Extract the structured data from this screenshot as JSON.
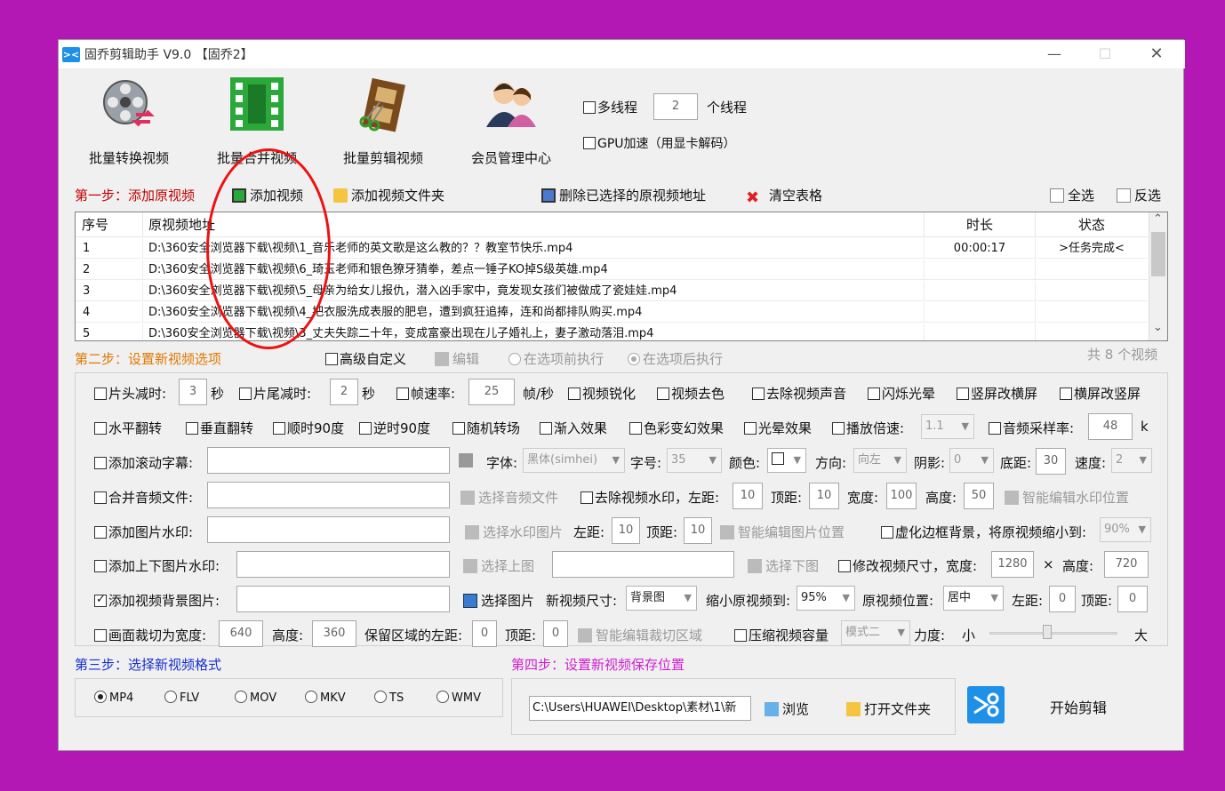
{
  "window": {
    "title": "固乔剪辑助手 V9.0 【固乔2】",
    "app_icon": "scissors-icon",
    "min_glyph": "—",
    "max_glyph": "☐",
    "close_glyph": "✕"
  },
  "toolbar": {
    "batch_convert": "批量转换视频",
    "batch_merge": "批量合并视频",
    "batch_edit": "批量剪辑视频",
    "member_center": "会员管理中心",
    "multithread_label": "多线程",
    "thread_count": "2",
    "thread_unit": "个线程",
    "gpu_label": "GPU加速（用显卡解码）"
  },
  "step1": {
    "title": "第一步：添加原视频",
    "add_video": "添加视频",
    "add_folder": "添加视频文件夹",
    "delete_selected": "删除已选择的原视频地址",
    "clear_table": "清空表格",
    "select_all": "全选",
    "invert": "反选"
  },
  "table": {
    "headers": [
      "序号",
      "原视频地址",
      "时长",
      "状态"
    ],
    "rows": [
      {
        "idx": "1",
        "path": "D:\\360安全浏览器下载\\视频\\1_音乐老师的英文歌是这么教的？？教室节快乐.mp4",
        "duration": "00:00:17",
        "status": ">任务完成<"
      },
      {
        "idx": "2",
        "path": "D:\\360安全浏览器下载\\视频\\6_琦玉老师和银色獠牙猜拳，差点一锤子KO掉S级英雄.mp4",
        "duration": "",
        "status": ""
      },
      {
        "idx": "3",
        "path": "D:\\360安全浏览器下载\\视频\\5_母亲为给女儿报仇，潜入凶手家中，竟发现女孩们被做成了瓷娃娃.mp4",
        "duration": "",
        "status": ""
      },
      {
        "idx": "4",
        "path": "D:\\360安全浏览器下载\\视频\\4_把衣服洗成表服的肥皂，遭到疯狂追捧，连和尚都排队购买.mp4",
        "duration": "",
        "status": ""
      },
      {
        "idx": "5",
        "path": "D:\\360安全浏览器下载\\视频\\3_丈夫失踪二十年，变成富豪出现在儿子婚礼上，妻子激动落泪.mp4",
        "duration": "",
        "status": ""
      }
    ],
    "scroll_up": "⌃",
    "scroll_down": "⌄"
  },
  "step2": {
    "title": "第二步：设置新视频选项",
    "advanced": "高级自定义",
    "edit": "编辑",
    "before": "在选项前执行",
    "after": "在选项后执行",
    "count_text": "共 8 个视频"
  },
  "opts": {
    "head_cut": "片头减时:",
    "head_val": "3",
    "sec1": "秒",
    "tail_cut": "片尾减时:",
    "tail_val": "2",
    "sec2": "秒",
    "fps": "帧速率:",
    "fps_val": "25",
    "fps_unit": "帧/秒",
    "sharpen": "视频锐化",
    "decolor": "视频去色",
    "remove_audio": "去除视频声音",
    "flash": "闪烁光晕",
    "v2h": "竖屏改横屏",
    "h2v": "横屏改竖屏",
    "hflip": "水平翻转",
    "vflip": "垂直翻转",
    "cw90": "顺时90度",
    "ccw90": "逆时90度",
    "random_trans": "随机转场",
    "fade_in": "渐入效果",
    "color_fx": "色彩变幻效果",
    "halo": "光晕效果",
    "speed": "播放倍速:",
    "speed_val": "1.1",
    "sample": "音频采样率:",
    "sample_val": "48",
    "sample_unit": "k",
    "subtitle": "添加滚动字幕:",
    "font": "字体:",
    "font_val": "黑体(simhei)",
    "size": "字号:",
    "size_val": "35",
    "color": "颜色:",
    "direction": "方向:",
    "direction_val": "向左",
    "shadow": "阴影:",
    "shadow_val": "0",
    "bottom": "底距:",
    "bottom_val": "30",
    "spd": "速度:",
    "spd_val": "2",
    "merge_audio": "合并音频文件:",
    "choose_audio": "选择音频文件",
    "remove_wm": "去除视频水印，左距:",
    "wm_left": "10",
    "wm_top_lbl": "顶距:",
    "wm_top": "10",
    "wm_w_lbl": "宽度:",
    "wm_w": "100",
    "wm_h_lbl": "高度:",
    "wm_h": "50",
    "smart_wm": "智能编辑水印位置",
    "img_wm": "添加图片水印:",
    "choose_wm": "选择水印图片",
    "iw_left_lbl": "左距:",
    "iw_left": "10",
    "iw_top_lbl": "顶距:",
    "iw_top": "10",
    "smart_img": "智能编辑图片位置",
    "blur": "虚化边框背景，将原视频缩小到:",
    "blur_val": "90%",
    "tb_img": "添加上下图片水印:",
    "choose_top": "选择上图",
    "choose_bottom": "选择下图",
    "resize": "修改视频尺寸，宽度:",
    "res_w": "1280",
    "times": "×",
    "res_h_lbl": "高度:",
    "res_h": "720",
    "bg_img": "添加视频背景图片:",
    "choose_img": "选择图片",
    "new_size": "新视频尺寸:",
    "new_size_val": "背景图",
    "shrink": "缩小原视频到:",
    "shrink_val": "95%",
    "pos": "原视频位置:",
    "pos_val": "居中",
    "bg_left_lbl": "左距:",
    "bg_left": "0",
    "bg_top_lbl": "顶距:",
    "bg_top": "0",
    "crop": "画面裁切为宽度:",
    "crop_w": "640",
    "crop_h_lbl": "高度:",
    "crop_h": "360",
    "keep": "保留区域的左距:",
    "keep_left": "0",
    "keep_top_lbl": "顶距:",
    "keep_top": "0",
    "smart_crop": "智能编辑裁切区域",
    "compress": "压缩视频容量",
    "mode_val": "模式二",
    "force": "力度:",
    "small": "小",
    "large": "大",
    "compress_level": 0.45
  },
  "step3": {
    "title": "第三步：选择新视频格式",
    "formats": [
      "MP4",
      "FLV",
      "MOV",
      "MKV",
      "TS",
      "WMV"
    ]
  },
  "step4": {
    "title": "第四步：设置新视频保存位置",
    "path": "C:\\Users\\HUAWEI\\Desktop\\素材\\1\\新",
    "browse": "浏览",
    "open_folder": "打开文件夹",
    "start": "开始剪辑"
  },
  "colors": {
    "background": "#b418b4",
    "highlight_circle": "#ee1111",
    "step1": "#c00000",
    "step2": "#e07800",
    "step3": "#1530d0",
    "step4": "#d020d0"
  }
}
